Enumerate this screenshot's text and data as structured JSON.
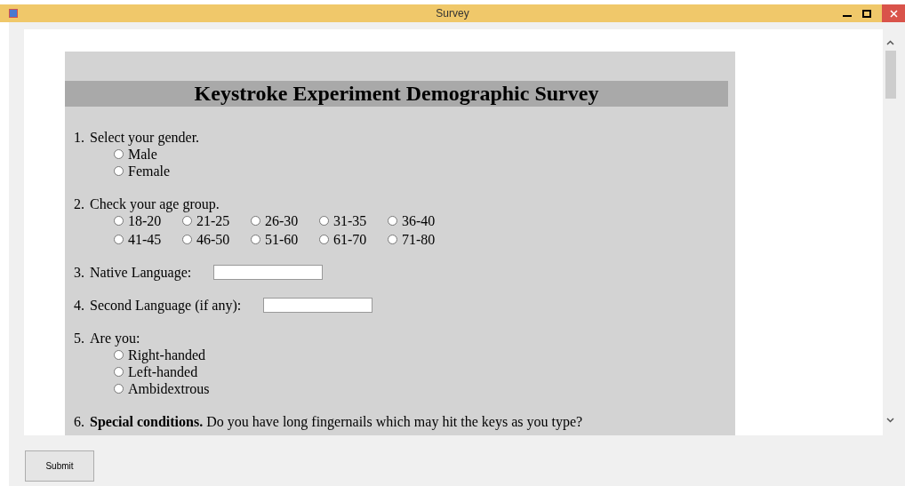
{
  "window": {
    "title": "Survey"
  },
  "survey": {
    "title": "Keystroke Experiment Demographic Survey",
    "questions": [
      {
        "kind": "radio",
        "number": "1.",
        "label": "Select your gender.",
        "options": [
          {
            "label": "Male",
            "selected": false
          },
          {
            "label": "Female",
            "selected": false
          }
        ]
      },
      {
        "kind": "grid",
        "number": "2.",
        "label": "Check your age group.",
        "options": [
          {
            "label": "18-20",
            "selected": false
          },
          {
            "label": "21-25",
            "selected": false
          },
          {
            "label": "26-30",
            "selected": false
          },
          {
            "label": "31-35",
            "selected": false
          },
          {
            "label": "36-40",
            "selected": false
          },
          {
            "label": "41-45",
            "selected": false
          },
          {
            "label": "46-50",
            "selected": false
          },
          {
            "label": "51-60",
            "selected": false
          },
          {
            "label": "61-70",
            "selected": false
          },
          {
            "label": "71-80",
            "selected": false
          }
        ]
      },
      {
        "kind": "text",
        "number": "3.",
        "label": "Native Language:"
      },
      {
        "kind": "text",
        "number": "4.",
        "label": "Second Language (if any):"
      },
      {
        "kind": "radio",
        "number": "5.",
        "label": "Are you:",
        "options": [
          {
            "label": "Right-handed",
            "selected": false
          },
          {
            "label": "Left-handed",
            "selected": false
          },
          {
            "label": "Ambidextrous",
            "selected": false
          }
        ]
      },
      {
        "kind": "radio",
        "number": "6.",
        "label": "**Special conditions.** Do you have long fingernails which may hit the keys as you type?"
      }
    ]
  },
  "buttons": [
    {
      "label": "Submit"
    }
  ]
}
